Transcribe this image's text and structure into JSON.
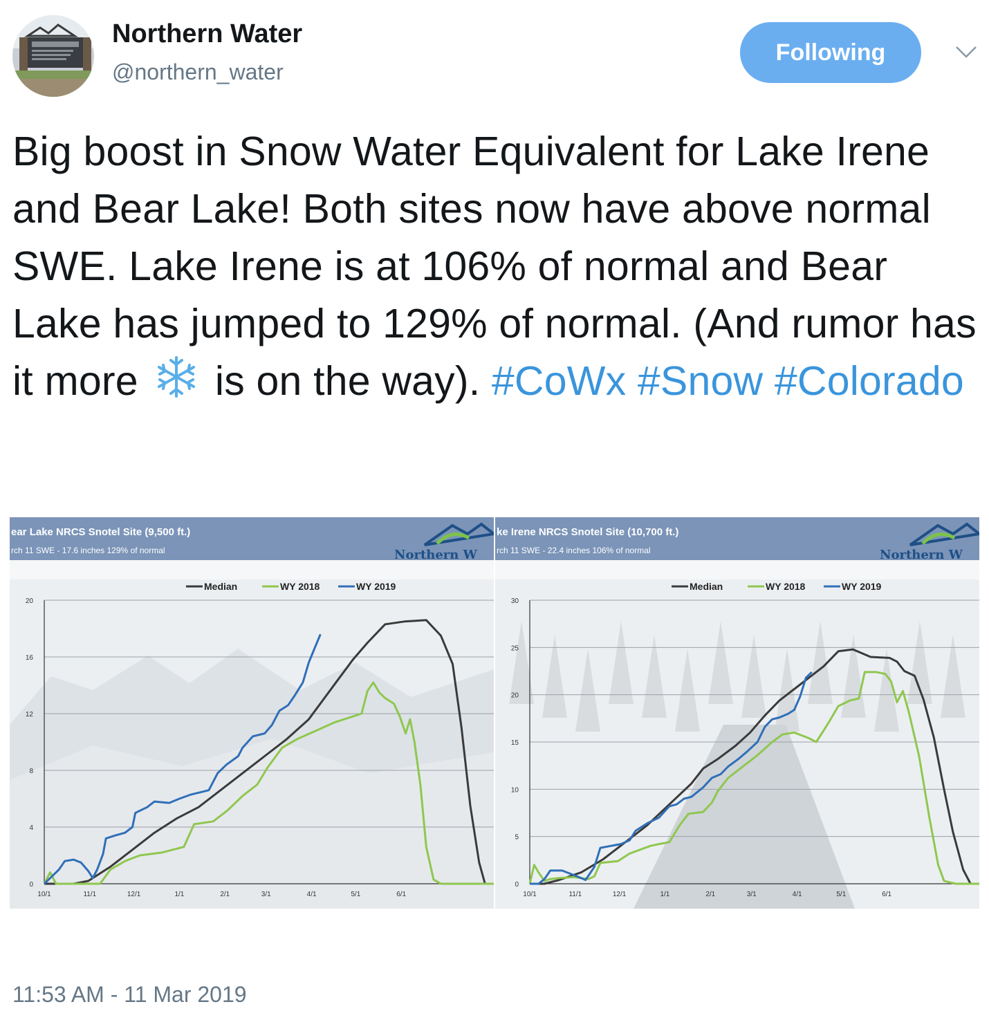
{
  "author": {
    "name": "Northern Water",
    "handle": "@northern_water",
    "avatar_icon": "northern-water-sign-avatar"
  },
  "follow_button": {
    "label": "Following"
  },
  "caret_icon": "chevron-down-icon",
  "tweet": {
    "text_before_emoji": "Big boost in Snow Water Equivalent for Lake Irene and Bear Lake! Both sites now have above normal SWE. Lake Irene is at 106% of normal and Bear Lake has jumped to 129% of normal. (And rumor has it more ",
    "emoji_icon": "snowflake-icon",
    "text_after_emoji": " is on the way). ",
    "hashtags": [
      "#CoWx",
      "#Snow",
      "#Colorado"
    ]
  },
  "timestamp": "11:53 AM - 11 Mar 2019",
  "colors": {
    "median": "#3a3a3a",
    "wy2018": "#8fc74f",
    "wy2019": "#2f6fb8",
    "header_band": "#7b94b8",
    "follow_button": "#6aaef0",
    "hashtag": "#3a95dc"
  },
  "chart_data": [
    {
      "type": "line",
      "title": "ear Lake NRCS Snotel Site (9,500 ft.)",
      "subtitle": "rch 11 SWE - 17.6 inches   129% of normal",
      "logo_text": "Northern W",
      "x_ticks": [
        "10/1",
        "11/1",
        "12/1",
        "1/1",
        "2/1",
        "3/1",
        "4/1",
        "5/1",
        "6/1"
      ],
      "y_ticks": [
        0,
        4,
        8,
        12,
        16,
        20
      ],
      "ylim": [
        0,
        20
      ],
      "grid": true,
      "legend": "top-center",
      "series": [
        {
          "name": "Median",
          "color_key": "median",
          "points": [
            [
              0,
              0
            ],
            [
              20,
              0
            ],
            [
              30,
              0.2
            ],
            [
              45,
              1.2
            ],
            [
              60,
              2.4
            ],
            [
              75,
              3.6
            ],
            [
              90,
              4.6
            ],
            [
              105,
              5.4
            ],
            [
              120,
              6.6
            ],
            [
              135,
              7.8
            ],
            [
              150,
              9.0
            ],
            [
              165,
              10.2
            ],
            [
              180,
              11.6
            ],
            [
              190,
              13.0
            ],
            [
              200,
              14.4
            ],
            [
              210,
              15.8
            ],
            [
              220,
              17.0
            ],
            [
              232,
              18.3
            ],
            [
              245,
              18.5
            ],
            [
              260,
              18.6
            ],
            [
              270,
              17.5
            ],
            [
              278,
              15.5
            ],
            [
              284,
              11.0
            ],
            [
              290,
              5.5
            ],
            [
              296,
              1.5
            ],
            [
              300,
              0
            ],
            [
              306,
              0
            ]
          ]
        },
        {
          "name": "WY 2018",
          "color_key": "wy2018",
          "points": [
            [
              0,
              0
            ],
            [
              4,
              0.8
            ],
            [
              8,
              0
            ],
            [
              38,
              0
            ],
            [
              45,
              1.0
            ],
            [
              55,
              1.6
            ],
            [
              65,
              2.0
            ],
            [
              80,
              2.2
            ],
            [
              95,
              2.6
            ],
            [
              102,
              4.2
            ],
            [
              115,
              4.4
            ],
            [
              125,
              5.2
            ],
            [
              135,
              6.2
            ],
            [
              145,
              7.0
            ],
            [
              152,
              8.2
            ],
            [
              162,
              9.6
            ],
            [
              172,
              10.2
            ],
            [
              185,
              10.8
            ],
            [
              198,
              11.4
            ],
            [
              210,
              11.8
            ],
            [
              216,
              12.0
            ],
            [
              220,
              13.6
            ],
            [
              224,
              14.2
            ],
            [
              228,
              13.5
            ],
            [
              232,
              13.1
            ],
            [
              238,
              12.7
            ],
            [
              242,
              11.8
            ],
            [
              246,
              10.6
            ],
            [
              249,
              11.6
            ],
            [
              252,
              10.0
            ],
            [
              256,
              7.0
            ],
            [
              260,
              2.6
            ],
            [
              265,
              0.3
            ],
            [
              270,
              0
            ],
            [
              306,
              0
            ]
          ]
        },
        {
          "name": "WY 2019",
          "color_key": "wy2019",
          "points": [
            [
              0,
              0
            ],
            [
              5,
              0.5
            ],
            [
              10,
              1.0
            ],
            [
              14,
              1.6
            ],
            [
              20,
              1.7
            ],
            [
              25,
              1.5
            ],
            [
              30,
              0.9
            ],
            [
              33,
              0.4
            ],
            [
              36,
              1.0
            ],
            [
              40,
              2.1
            ],
            [
              42,
              3.2
            ],
            [
              48,
              3.4
            ],
            [
              55,
              3.6
            ],
            [
              60,
              4.0
            ],
            [
              62,
              5.0
            ],
            [
              70,
              5.4
            ],
            [
              75,
              5.8
            ],
            [
              85,
              5.7
            ],
            [
              92,
              6.0
            ],
            [
              100,
              6.3
            ],
            [
              108,
              6.5
            ],
            [
              112,
              6.6
            ],
            [
              118,
              7.8
            ],
            [
              124,
              8.4
            ],
            [
              132,
              9.0
            ],
            [
              135,
              9.6
            ],
            [
              142,
              10.4
            ],
            [
              150,
              10.6
            ],
            [
              155,
              11.2
            ],
            [
              160,
              12.2
            ],
            [
              166,
              12.6
            ],
            [
              170,
              13.2
            ],
            [
              176,
              14.2
            ],
            [
              180,
              15.6
            ],
            [
              184,
              16.6
            ],
            [
              188,
              17.6
            ]
          ]
        }
      ]
    },
    {
      "type": "line",
      "title": "ke Irene NRCS Snotel Site (10,700 ft.)",
      "subtitle": "rch 11 SWE - 22.4 inches   106% of normal",
      "logo_text": "Northern W",
      "x_ticks": [
        "10/1",
        "11/1",
        "12/1",
        "1/1",
        "2/1",
        "3/1",
        "4/1",
        "5/1",
        "6/1"
      ],
      "y_ticks": [
        0,
        5,
        10,
        15,
        20,
        25,
        30
      ],
      "ylim": [
        0,
        30
      ],
      "grid": true,
      "legend": "top-center",
      "series": [
        {
          "name": "Median",
          "color_key": "median",
          "points": [
            [
              0,
              0
            ],
            [
              10,
              0
            ],
            [
              20,
              0.4
            ],
            [
              35,
              1.2
            ],
            [
              50,
              2.6
            ],
            [
              65,
              4.4
            ],
            [
              80,
              6.2
            ],
            [
              95,
              8.4
            ],
            [
              110,
              10.6
            ],
            [
              118,
              12.2
            ],
            [
              128,
              13.2
            ],
            [
              140,
              14.6
            ],
            [
              150,
              16.0
            ],
            [
              160,
              17.8
            ],
            [
              170,
              19.4
            ],
            [
              180,
              20.6
            ],
            [
              190,
              21.8
            ],
            [
              200,
              23.0
            ],
            [
              210,
              24.6
            ],
            [
              220,
              24.8
            ],
            [
              232,
              24.0
            ],
            [
              245,
              23.9
            ],
            [
              250,
              23.5
            ],
            [
              255,
              22.5
            ],
            [
              262,
              22.0
            ],
            [
              268,
              19.5
            ],
            [
              275,
              15.5
            ],
            [
              282,
              10.0
            ],
            [
              288,
              5.5
            ],
            [
              295,
              1.5
            ],
            [
              300,
              0
            ],
            [
              306,
              0
            ]
          ]
        },
        {
          "name": "WY 2018",
          "color_key": "wy2018",
          "points": [
            [
              0,
              0
            ],
            [
              3,
              2.0
            ],
            [
              6,
              1.2
            ],
            [
              10,
              0.3
            ],
            [
              14,
              0.5
            ],
            [
              20,
              0.6
            ],
            [
              30,
              0.7
            ],
            [
              40,
              0.5
            ],
            [
              44,
              0.8
            ],
            [
              48,
              2.2
            ],
            [
              60,
              2.4
            ],
            [
              68,
              3.2
            ],
            [
              75,
              3.6
            ],
            [
              82,
              4.0
            ],
            [
              88,
              4.2
            ],
            [
              95,
              4.4
            ],
            [
              102,
              6.2
            ],
            [
              108,
              7.4
            ],
            [
              118,
              7.6
            ],
            [
              124,
              8.6
            ],
            [
              128,
              9.8
            ],
            [
              135,
              11.2
            ],
            [
              145,
              12.4
            ],
            [
              155,
              13.6
            ],
            [
              165,
              15.0
            ],
            [
              172,
              15.8
            ],
            [
              180,
              16.0
            ],
            [
              190,
              15.4
            ],
            [
              195,
              15.0
            ],
            [
              200,
              16.2
            ],
            [
              204,
              17.2
            ],
            [
              210,
              18.8
            ],
            [
              218,
              19.4
            ],
            [
              224,
              19.6
            ],
            [
              228,
              22.4
            ],
            [
              236,
              22.4
            ],
            [
              242,
              22.2
            ],
            [
              246,
              21.4
            ],
            [
              250,
              19.2
            ],
            [
              254,
              20.4
            ],
            [
              258,
              18.2
            ],
            [
              265,
              13.5
            ],
            [
              272,
              7.0
            ],
            [
              278,
              2.0
            ],
            [
              282,
              0.3
            ],
            [
              290,
              0
            ],
            [
              306,
              0
            ]
          ]
        },
        {
          "name": "WY 2019",
          "color_key": "wy2019",
          "points": [
            [
              0,
              0
            ],
            [
              6,
              0
            ],
            [
              10,
              0.5
            ],
            [
              14,
              1.4
            ],
            [
              22,
              1.4
            ],
            [
              32,
              0.8
            ],
            [
              38,
              0.4
            ],
            [
              44,
              1.8
            ],
            [
              48,
              3.8
            ],
            [
              55,
              4.0
            ],
            [
              62,
              4.2
            ],
            [
              68,
              4.6
            ],
            [
              72,
              5.6
            ],
            [
              80,
              6.4
            ],
            [
              88,
              7.0
            ],
            [
              95,
              8.2
            ],
            [
              100,
              8.4
            ],
            [
              105,
              9.0
            ],
            [
              110,
              9.2
            ],
            [
              118,
              10.2
            ],
            [
              124,
              11.2
            ],
            [
              130,
              11.6
            ],
            [
              135,
              12.4
            ],
            [
              142,
              13.2
            ],
            [
              148,
              14.0
            ],
            [
              155,
              15.0
            ],
            [
              160,
              16.6
            ],
            [
              165,
              17.4
            ],
            [
              170,
              17.6
            ],
            [
              176,
              18.0
            ],
            [
              180,
              18.4
            ],
            [
              184,
              19.8
            ],
            [
              188,
              21.8
            ],
            [
              192,
              22.4
            ]
          ]
        }
      ]
    }
  ]
}
